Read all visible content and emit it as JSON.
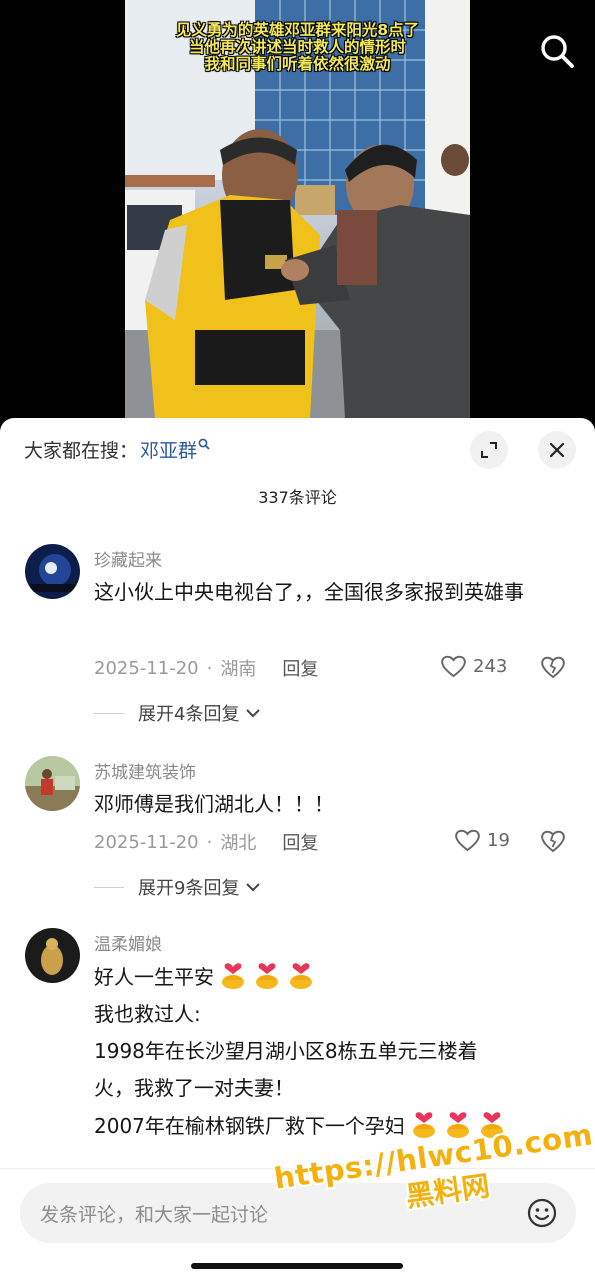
{
  "video": {
    "subtitle": [
      "见义勇为的英雄邓亚群来阳光8点了",
      "当他再次讲述当时救人的情形时",
      "我和同事们听着依然很激动"
    ],
    "search_icon": "search-icon"
  },
  "sheet": {
    "hot_search_prefix": "大家都在搜：",
    "hot_search_term": "邓亚群",
    "hot_search_term_icon": "search-icon",
    "expand_icon": "fullscreen-icon",
    "close_icon": "close-icon",
    "comment_count": "337条评论"
  },
  "comments": [
    {
      "user": "珍藏起来",
      "text": "这小伙上中央电视台了，，全国很多家报到英雄事",
      "date": "2025-11-20",
      "location": "湖南",
      "reply_label": "回复",
      "likes": "243",
      "expand_label": "展开4条回复"
    },
    {
      "user": "苏城建筑装饰",
      "text": "邓师傅是我们湖北人！！！",
      "date": "2025-11-20",
      "location": "湖北",
      "reply_label": "回复",
      "likes": "19",
      "expand_label": "展开9条回复"
    },
    {
      "user": "温柔媚娘",
      "lines": [
        "好人一生平安",
        "我也救过人:",
        "1998年在长沙望月湖小区8栋五单元三楼着",
        "火，我救了一对夫妻！",
        "2007年在榆林钢铁厂救下一个孕妇"
      ]
    }
  ],
  "input": {
    "placeholder": "发条评论，和大家一起讨论",
    "icons": [
      "emoji-icon"
    ]
  },
  "watermark": {
    "url": "https://hlwc10.com",
    "site": "黑料网"
  },
  "colors": {
    "link_blue": "#2f5a99",
    "subtitle_yellow": "#f3e85a",
    "watermark_orange": "#f4b10e"
  }
}
